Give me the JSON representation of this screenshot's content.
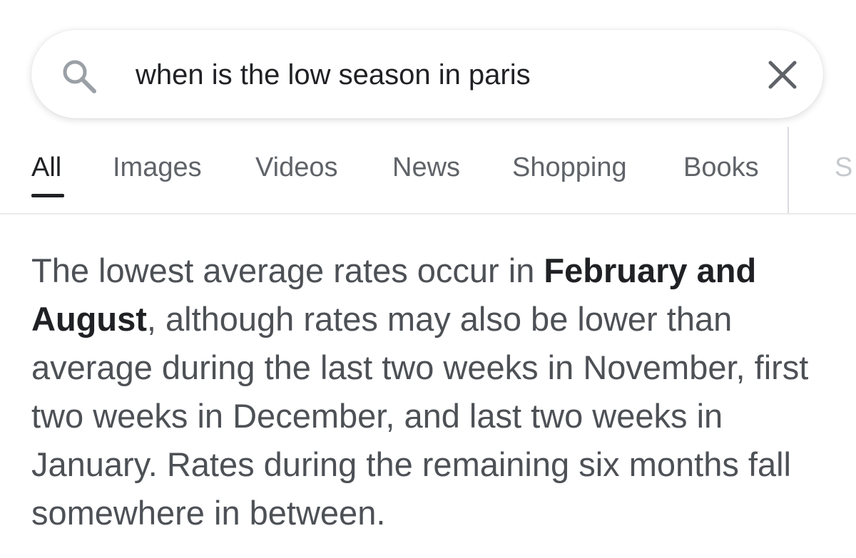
{
  "search": {
    "query": "when is the low season in paris",
    "icon": "search-icon",
    "clear_icon": "close-icon"
  },
  "tabs": [
    {
      "label": "All",
      "active": true
    },
    {
      "label": "Images",
      "active": false
    },
    {
      "label": "Videos",
      "active": false
    },
    {
      "label": "News",
      "active": false
    },
    {
      "label": "Shopping",
      "active": false
    },
    {
      "label": "Books",
      "active": false
    },
    {
      "label": "S",
      "active": false
    }
  ],
  "snippet": {
    "part1": "The lowest average rates occur in ",
    "bold": "February and August",
    "part2": ", although rates may also be lower than average during the last two weeks in November, first two weeks in December, and last two weeks in January. Rates during the remaining six months fall somewhere in between."
  },
  "colors": {
    "active_tab": "#202124",
    "inactive_tab": "#5f6368",
    "body_text": "#4d5156",
    "bold_text": "#202124"
  }
}
